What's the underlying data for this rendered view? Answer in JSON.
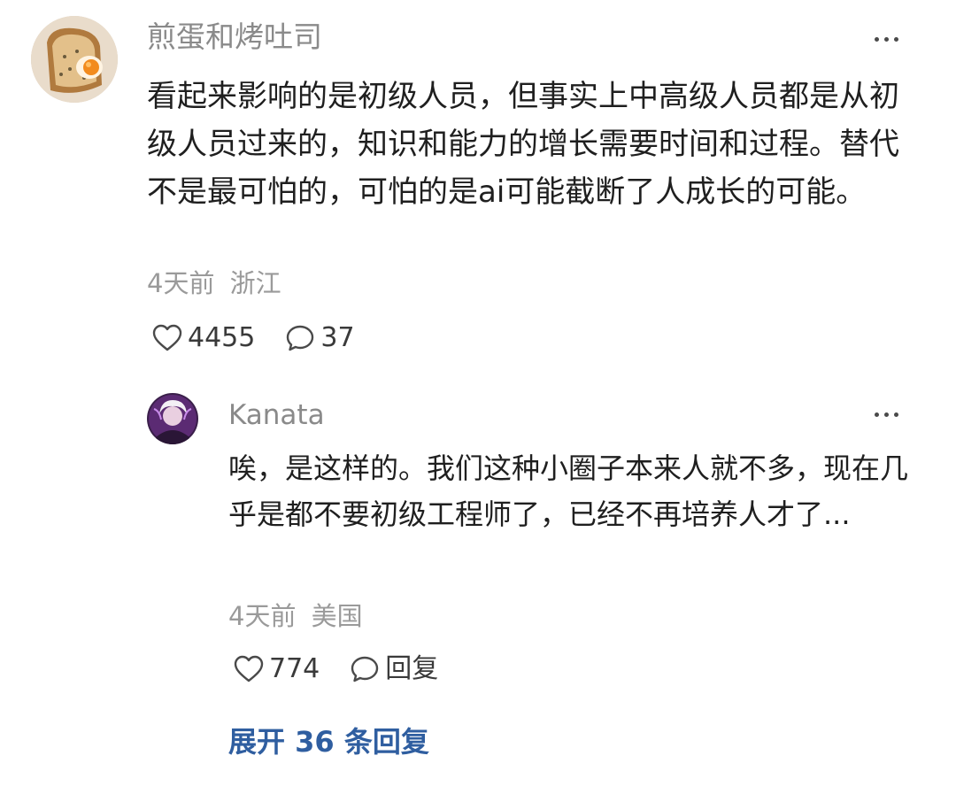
{
  "comments": [
    {
      "username": "煎蛋和烤吐司",
      "text": "看起来影响的是初级人员，但事实上中高级人员都是从初级人员过来的，知识和能力的增长需要时间和过程。替代不是最可怕的，可怕的是ai可能截断了人成长的可能。",
      "time": "4天前",
      "location": "浙江",
      "likes": "4455",
      "replies": "37"
    },
    {
      "username": "Kanata",
      "text": "唉，是这样的。我们这种小圈子本来人就不多，现在几乎是都不要初级工程师了，已经不再培养人才了...",
      "time": "4天前",
      "location": "美国",
      "likes": "774",
      "reply_label": "回复"
    }
  ],
  "expand_replies": "展开 36 条回复",
  "icons": {
    "like": "heart-outline-icon",
    "comment": "speech-bubble-icon",
    "more": "more-dots-icon"
  },
  "colors": {
    "username": "#8a8a8a",
    "meta": "#9a9a9a",
    "link": "#2f5ea0",
    "text": "#1f1f1f"
  }
}
